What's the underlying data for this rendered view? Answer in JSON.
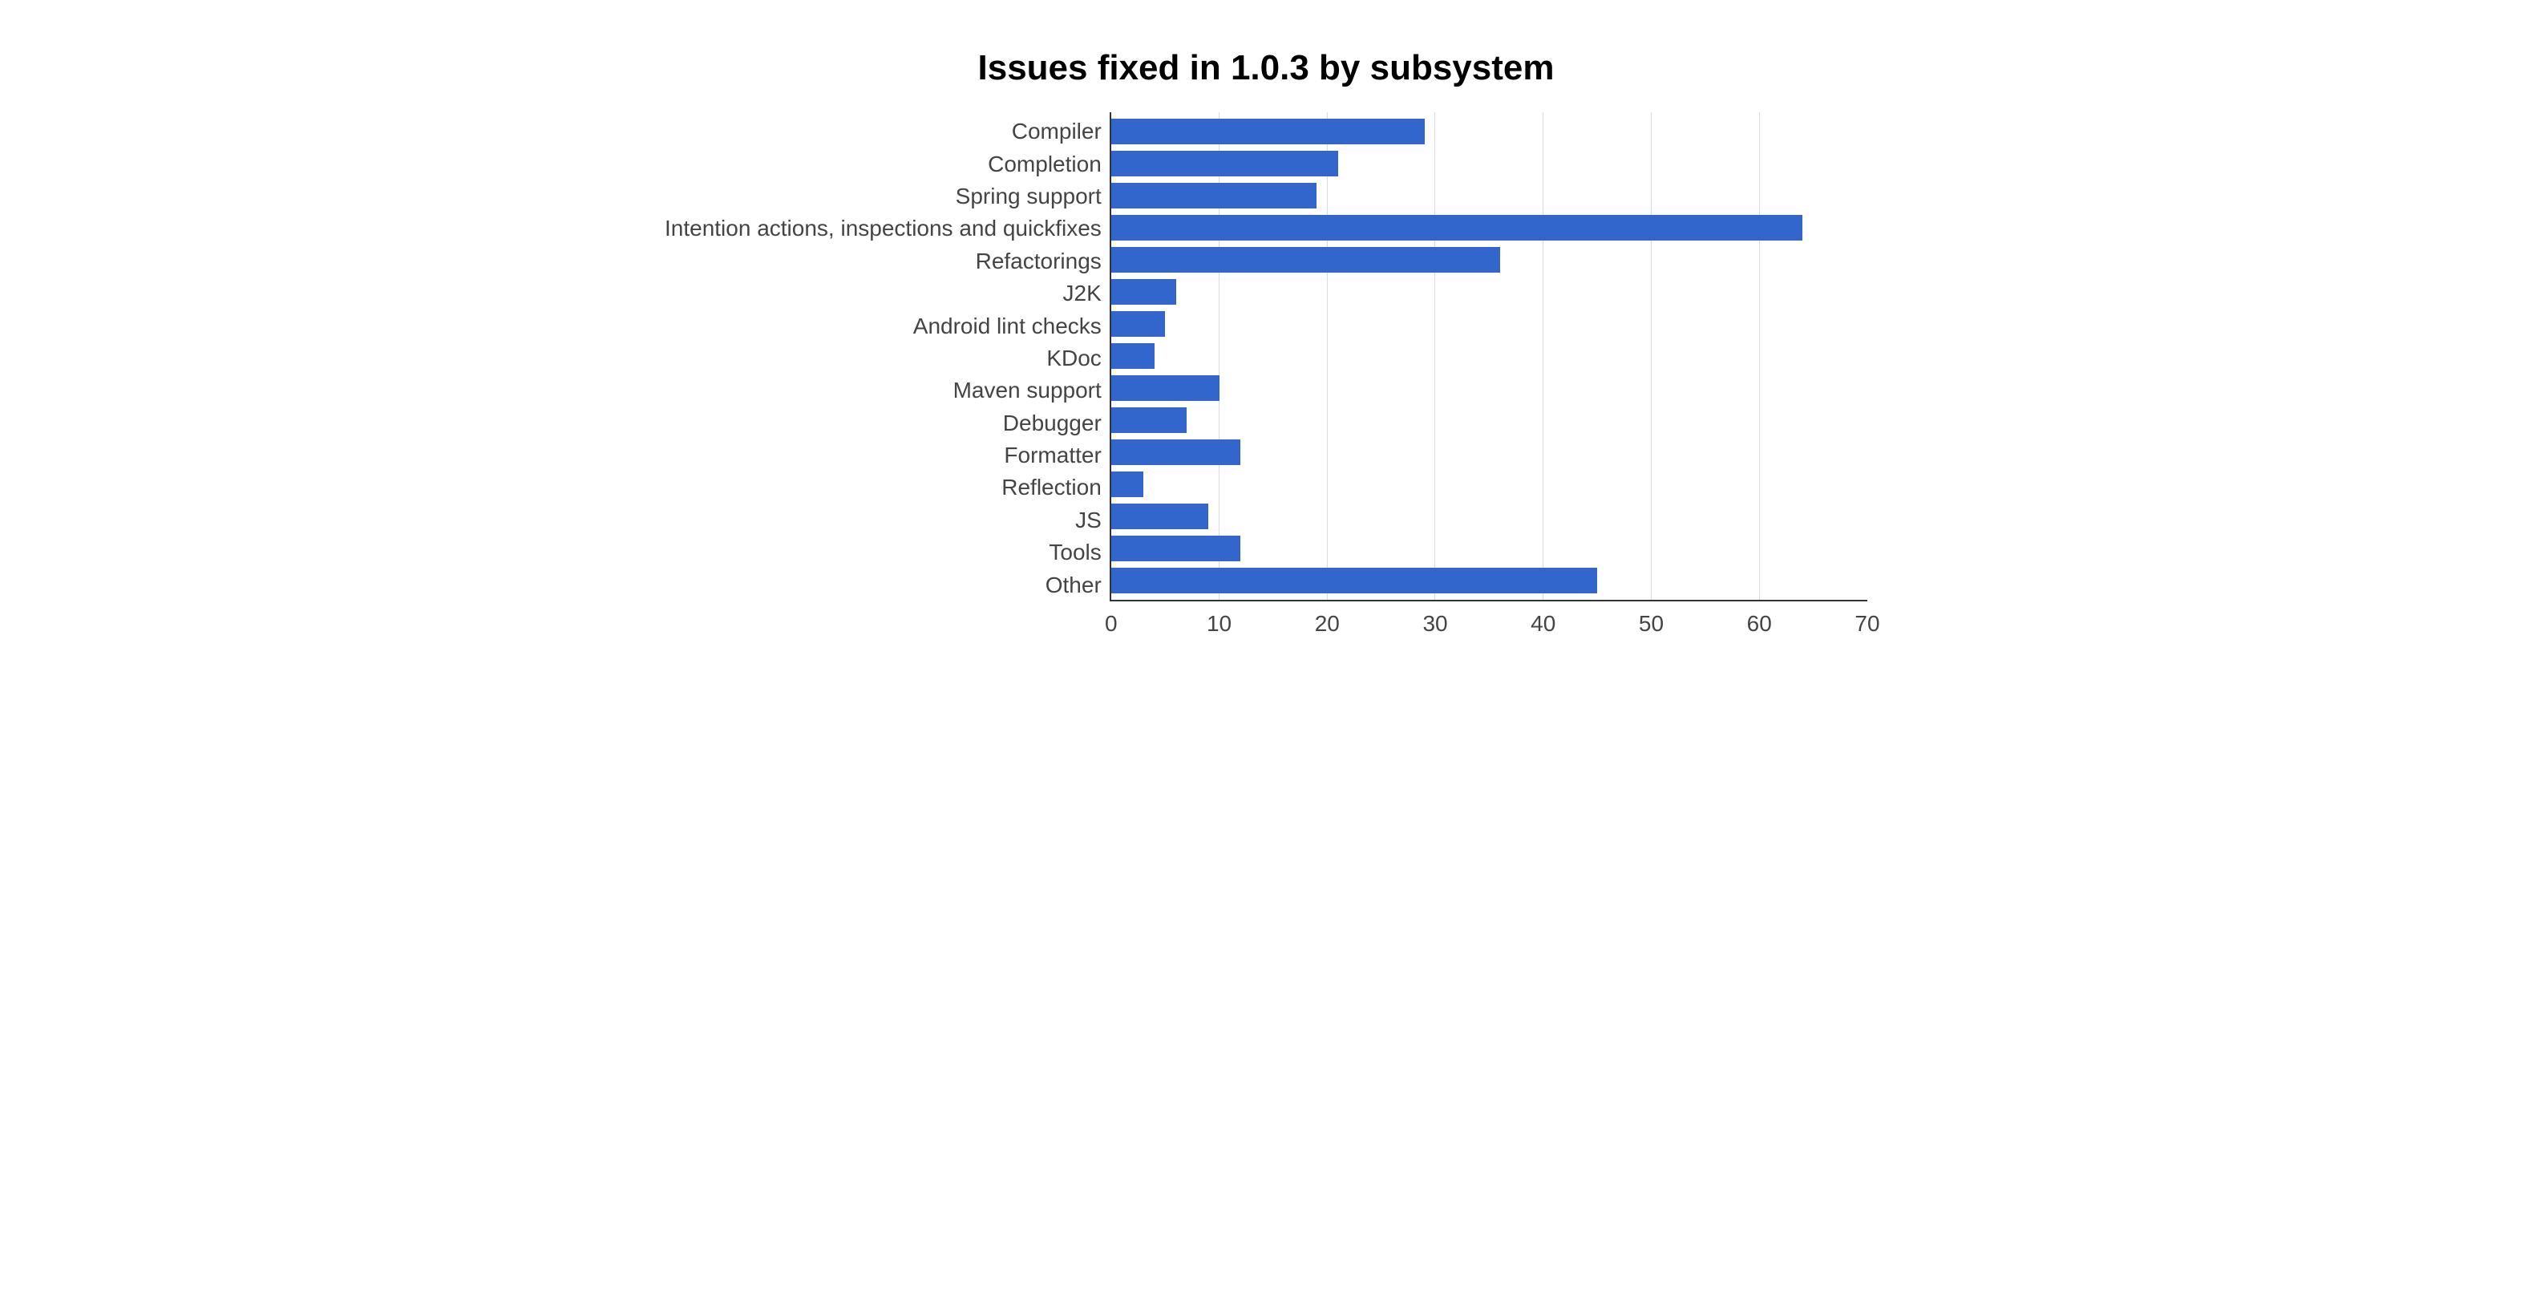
{
  "chart_data": {
    "type": "bar",
    "orientation": "horizontal",
    "title": "Issues fixed in 1.0.3 by subsystem",
    "xlabel": "",
    "ylabel": "",
    "xlim": [
      0,
      70
    ],
    "x_ticks": [
      0,
      10,
      20,
      30,
      40,
      50,
      60,
      70
    ],
    "categories": [
      "Compiler",
      "Completion",
      "Spring support",
      "Intention actions, inspections and quickfixes",
      "Refactorings",
      "J2K",
      "Android lint checks",
      "KDoc",
      "Maven support",
      "Debugger",
      "Formatter",
      "Reflection",
      "JS",
      "Tools",
      "Other"
    ],
    "values": [
      29,
      21,
      19,
      64,
      36,
      6,
      5,
      4,
      10,
      7,
      12,
      3,
      9,
      12,
      45
    ],
    "bar_color": "#3366cc",
    "grid": true
  }
}
